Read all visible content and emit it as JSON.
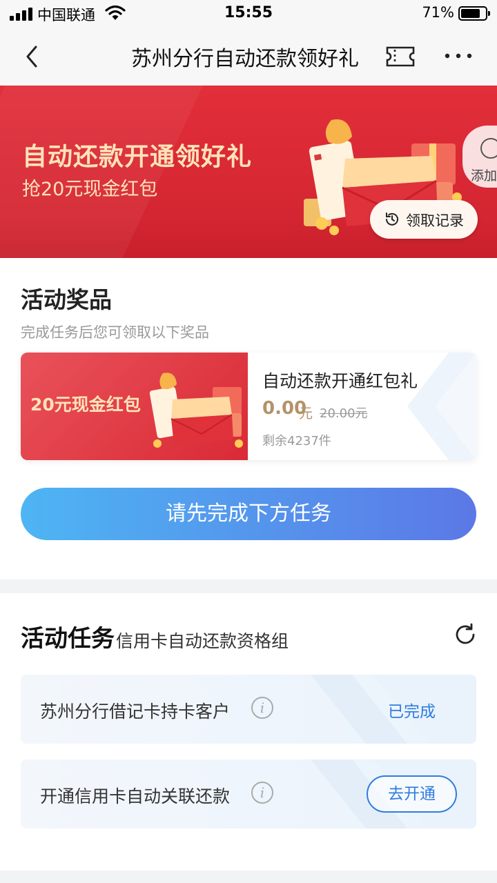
{
  "status_bar": {
    "carrier": "中国联通",
    "time": "15:55",
    "battery": "71%"
  },
  "nav": {
    "title": "苏州分行自动还款领好礼",
    "icons": [
      "back-icon",
      "ticket-icon",
      "more-icon"
    ]
  },
  "banner": {
    "title": "自动还款开通领好礼",
    "subtitle": "抢20元现金红包",
    "add_label": "添加",
    "record_label": "领取记录"
  },
  "prize": {
    "title": "活动奖品",
    "subtitle": "完成任务后您可领取以下奖品",
    "card_label": "20元现金红包",
    "name": "自动还款开通红包礼",
    "price": "0.00",
    "unit": "元",
    "original_price": "20.00元",
    "stock": "剩余4237件",
    "cta_label": "请先完成下方任务"
  },
  "tasks": {
    "title": "活动任务",
    "group": "信用卡自动还款资格组",
    "items": [
      {
        "label": "苏州分行借记卡持卡客户",
        "status": "已完成"
      },
      {
        "label": "开通信用卡自动关联还款",
        "action": "去开通"
      }
    ]
  },
  "colors": {
    "banner_red": "#d42632",
    "gold_text": "#ffe3b8",
    "price_gold": "#b3926b",
    "link_blue": "#2e7ce0",
    "cta_start": "#4eb5f3",
    "cta_end": "#5b78e6"
  }
}
